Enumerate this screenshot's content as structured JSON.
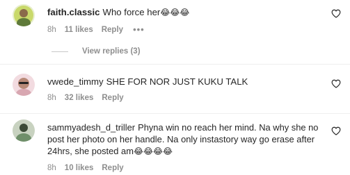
{
  "comments": [
    {
      "username": "faith.classic",
      "text": "Who force her",
      "emojis": "😂😂😂",
      "time": "8h",
      "likes": "11 likes",
      "reply": "Reply",
      "more": "•••",
      "replies": "View replies (3)",
      "avatar_color": "#c9d96b"
    },
    {
      "username": "vwede_timmy",
      "text": "SHE FOR NOR JUST KUKU TALK",
      "emojis": "",
      "time": "8h",
      "likes": "32 likes",
      "reply": "Reply",
      "avatar_color": "#d8a7b1"
    },
    {
      "username": "sammyadesh_d_triller",
      "text": "Phyna win no reach her mind. Na why she no post her photo on her handle. Na only instastory way go erase after 24hrs, she posted am",
      "emojis": "😂😂😂😂",
      "time": "8h",
      "likes": "10 likes",
      "reply": "Reply",
      "avatar_color": "#6f8f6a"
    }
  ],
  "icons": {
    "heart": "heart-outline-icon"
  },
  "colors": {
    "text": "#262626",
    "muted": "#8e8e8e"
  }
}
